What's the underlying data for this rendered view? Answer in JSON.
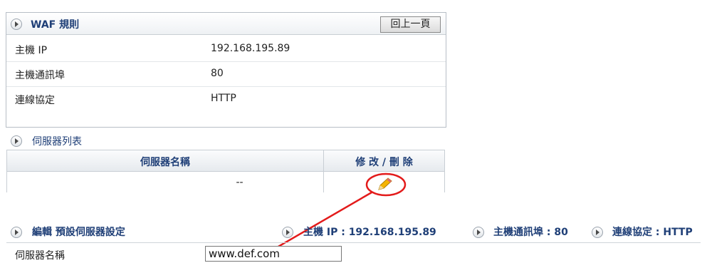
{
  "waf": {
    "title": "WAF 規則",
    "back_label": "回上一頁",
    "rows": [
      {
        "label": "主機 IP",
        "value": "192.168.195.89"
      },
      {
        "label": "主機通訊埠",
        "value": "80"
      },
      {
        "label": "連線協定",
        "value": "HTTP"
      }
    ]
  },
  "server_list": {
    "title": "伺服器列表",
    "columns": [
      "伺服器名稱",
      "修 改 / 刪 除"
    ],
    "rows": [
      {
        "name": "--"
      }
    ]
  },
  "edit": {
    "title": "編輯 預設伺服器設定",
    "host_ip": "主機 IP : 192.168.195.89",
    "host_port": "主機通訊埠 : 80",
    "protocol": "連線協定 : HTTP",
    "field_label": "伺服器名稱",
    "field_value": "www.def.com"
  },
  "colors": {
    "accent": "#1f3f77",
    "annotation": "#e31b1b",
    "pencil": "#f5b400"
  }
}
